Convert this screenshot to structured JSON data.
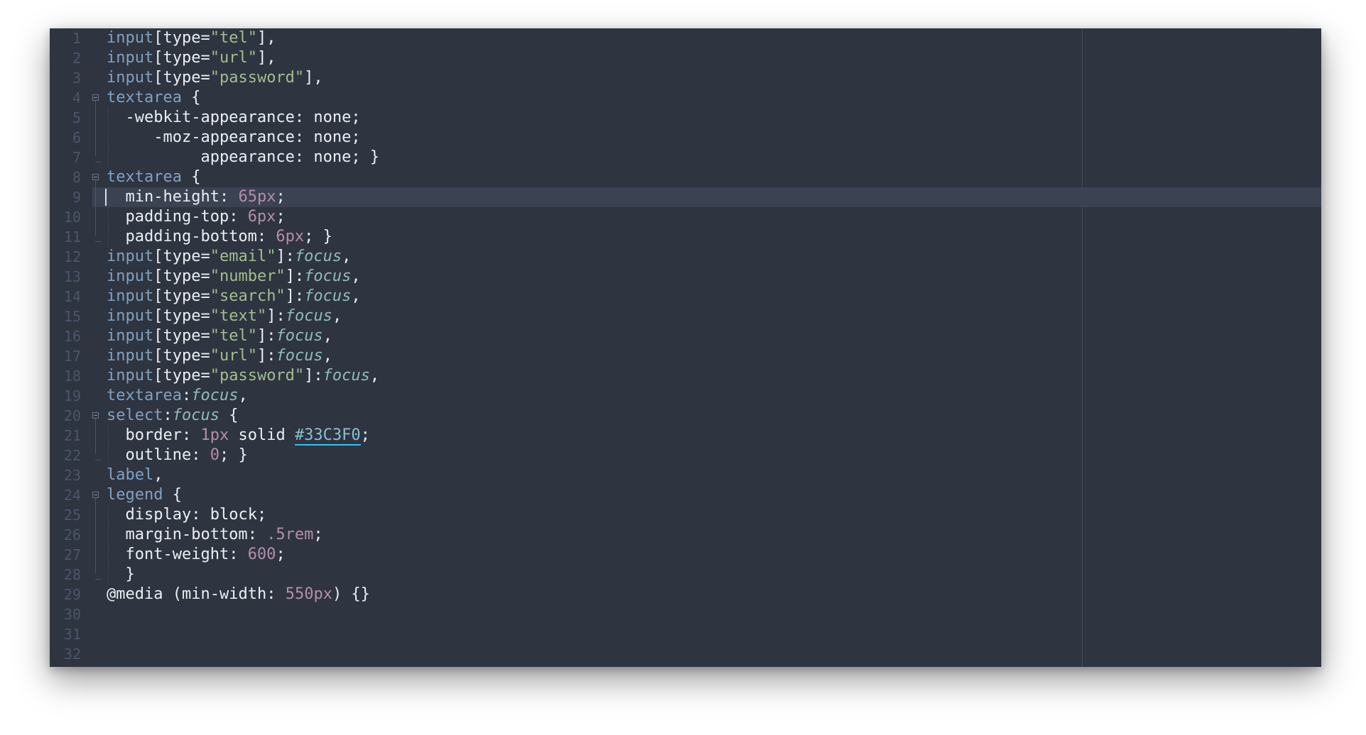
{
  "editor": {
    "language": "css",
    "total_lines": 32,
    "active_line": 9,
    "line_numbers": [
      "1",
      "2",
      "3",
      "4",
      "5",
      "6",
      "7",
      "8",
      "9",
      "10",
      "11",
      "12",
      "13",
      "14",
      "15",
      "16",
      "17",
      "18",
      "19",
      "20",
      "21",
      "22",
      "23",
      "24",
      "25",
      "26",
      "27",
      "28",
      "29",
      "30",
      "31",
      "32"
    ],
    "lines": [
      [
        [
          "input",
          "kw"
        ],
        [
          "[",
          "p"
        ],
        [
          "type",
          "p"
        ],
        [
          "=",
          "p"
        ],
        [
          "\"tel\"",
          "s"
        ],
        [
          "],",
          "p"
        ]
      ],
      [
        [
          "input",
          "kw"
        ],
        [
          "[",
          "p"
        ],
        [
          "type",
          "p"
        ],
        [
          "=",
          "p"
        ],
        [
          "\"url\"",
          "s"
        ],
        [
          "],",
          "p"
        ]
      ],
      [
        [
          "input",
          "kw"
        ],
        [
          "[",
          "p"
        ],
        [
          "type",
          "p"
        ],
        [
          "=",
          "p"
        ],
        [
          "\"password\"",
          "s"
        ],
        [
          "],",
          "p"
        ]
      ],
      [
        [
          "textarea",
          "kw"
        ],
        [
          " {",
          "pn"
        ]
      ],
      [
        [
          "  -webkit-appearance",
          "p"
        ],
        [
          ": ",
          "pn"
        ],
        [
          "none",
          "p"
        ],
        [
          ";",
          "pn"
        ]
      ],
      [
        [
          "     -moz-appearance",
          "p"
        ],
        [
          ": ",
          "pn"
        ],
        [
          "none",
          "p"
        ],
        [
          ";",
          "pn"
        ]
      ],
      [
        [
          "          appearance",
          "p"
        ],
        [
          ": ",
          "pn"
        ],
        [
          "none",
          "p"
        ],
        [
          "; }",
          "pn"
        ]
      ],
      [
        [
          "textarea",
          "kw"
        ],
        [
          " {",
          "pn"
        ]
      ],
      [
        [
          "  min-height",
          "p"
        ],
        [
          ": ",
          "pn"
        ],
        [
          "65px",
          "n"
        ],
        [
          ";",
          "pn"
        ]
      ],
      [
        [
          "  padding-top",
          "p"
        ],
        [
          ": ",
          "pn"
        ],
        [
          "6px",
          "n"
        ],
        [
          ";",
          "pn"
        ]
      ],
      [
        [
          "  padding-bottom",
          "p"
        ],
        [
          ": ",
          "pn"
        ],
        [
          "6px",
          "n"
        ],
        [
          "; }",
          "pn"
        ]
      ],
      [
        [
          "input",
          "kw"
        ],
        [
          "[",
          "p"
        ],
        [
          "type",
          "p"
        ],
        [
          "=",
          "p"
        ],
        [
          "\"email\"",
          "s"
        ],
        [
          "]:",
          "p"
        ],
        [
          "focus",
          "ps"
        ],
        [
          ",",
          "pn"
        ]
      ],
      [
        [
          "input",
          "kw"
        ],
        [
          "[",
          "p"
        ],
        [
          "type",
          "p"
        ],
        [
          "=",
          "p"
        ],
        [
          "\"number\"",
          "s"
        ],
        [
          "]:",
          "p"
        ],
        [
          "focus",
          "ps"
        ],
        [
          ",",
          "pn"
        ]
      ],
      [
        [
          "input",
          "kw"
        ],
        [
          "[",
          "p"
        ],
        [
          "type",
          "p"
        ],
        [
          "=",
          "p"
        ],
        [
          "\"search\"",
          "s"
        ],
        [
          "]:",
          "p"
        ],
        [
          "focus",
          "ps"
        ],
        [
          ",",
          "pn"
        ]
      ],
      [
        [
          "input",
          "kw"
        ],
        [
          "[",
          "p"
        ],
        [
          "type",
          "p"
        ],
        [
          "=",
          "p"
        ],
        [
          "\"text\"",
          "s"
        ],
        [
          "]:",
          "p"
        ],
        [
          "focus",
          "ps"
        ],
        [
          ",",
          "pn"
        ]
      ],
      [
        [
          "input",
          "kw"
        ],
        [
          "[",
          "p"
        ],
        [
          "type",
          "p"
        ],
        [
          "=",
          "p"
        ],
        [
          "\"tel\"",
          "s"
        ],
        [
          "]:",
          "p"
        ],
        [
          "focus",
          "ps"
        ],
        [
          ",",
          "pn"
        ]
      ],
      [
        [
          "input",
          "kw"
        ],
        [
          "[",
          "p"
        ],
        [
          "type",
          "p"
        ],
        [
          "=",
          "p"
        ],
        [
          "\"url\"",
          "s"
        ],
        [
          "]:",
          "p"
        ],
        [
          "focus",
          "ps"
        ],
        [
          ",",
          "pn"
        ]
      ],
      [
        [
          "input",
          "kw"
        ],
        [
          "[",
          "p"
        ],
        [
          "type",
          "p"
        ],
        [
          "=",
          "p"
        ],
        [
          "\"password\"",
          "s"
        ],
        [
          "]:",
          "p"
        ],
        [
          "focus",
          "ps"
        ],
        [
          ",",
          "pn"
        ]
      ],
      [
        [
          "textarea",
          "kw"
        ],
        [
          ":",
          "p"
        ],
        [
          "focus",
          "ps"
        ],
        [
          ",",
          "pn"
        ]
      ],
      [
        [
          "select",
          "kw"
        ],
        [
          ":",
          "p"
        ],
        [
          "focus",
          "ps"
        ],
        [
          " {",
          "pn"
        ]
      ],
      [
        [
          "  border",
          "p"
        ],
        [
          ": ",
          "pn"
        ],
        [
          "1px",
          "n"
        ],
        [
          " solid ",
          "p"
        ],
        [
          "#33C3F0",
          "hex"
        ],
        [
          ";",
          "pn"
        ]
      ],
      [
        [
          "  outline",
          "p"
        ],
        [
          ": ",
          "pn"
        ],
        [
          "0",
          "n"
        ],
        [
          "; }",
          "pn"
        ]
      ],
      [
        [
          "label",
          "kw"
        ],
        [
          ",",
          "pn"
        ]
      ],
      [
        [
          "legend",
          "kw"
        ],
        [
          " {",
          "pn"
        ]
      ],
      [
        [
          "  display",
          "p"
        ],
        [
          ": ",
          "pn"
        ],
        [
          "block",
          "p"
        ],
        [
          ";",
          "pn"
        ]
      ],
      [
        [
          "  margin-bottom",
          "p"
        ],
        [
          ": ",
          "pn"
        ],
        [
          ".5rem",
          "n"
        ],
        [
          ";",
          "pn"
        ]
      ],
      [
        [
          "  font-weight",
          "p"
        ],
        [
          ": ",
          "pn"
        ],
        [
          "600",
          "n"
        ],
        [
          ";",
          "pn"
        ]
      ],
      [
        [
          "  }",
          "pn"
        ]
      ],
      [
        [
          "@",
          "pn"
        ],
        [
          "media",
          "p"
        ],
        [
          " (",
          "pn"
        ],
        [
          "min-width",
          "p"
        ],
        [
          ": ",
          "pn"
        ],
        [
          "550px",
          "n"
        ],
        [
          ") {}",
          "pn"
        ]
      ],
      [],
      [],
      []
    ]
  }
}
